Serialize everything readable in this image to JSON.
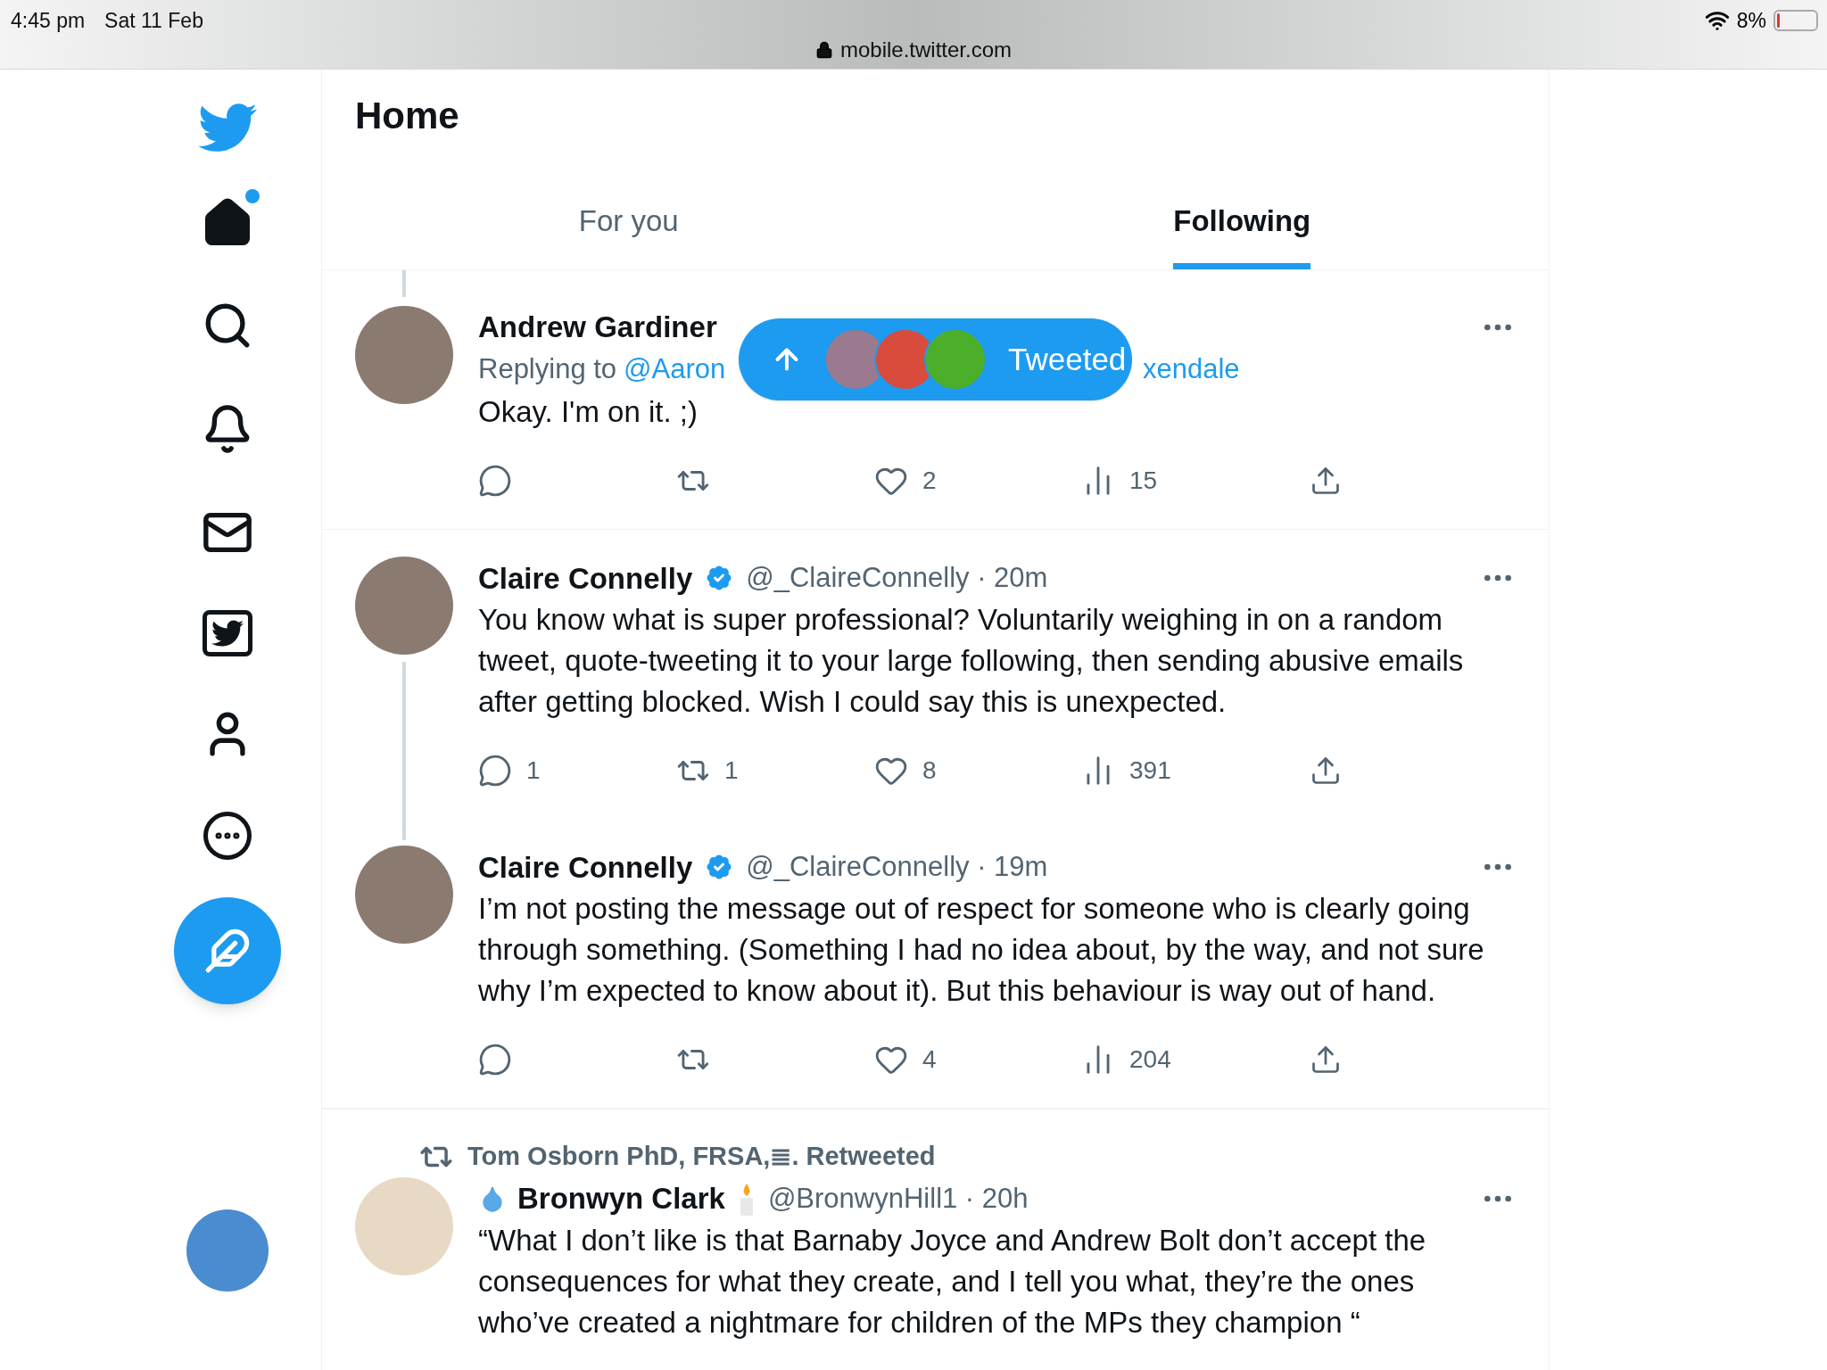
{
  "status_bar": {
    "time": "4:45 pm",
    "date": "Sat 11 Feb",
    "url": "mobile.twitter.com",
    "battery": "8%"
  },
  "sidebar": {
    "home_unread": true
  },
  "header": {
    "title": "Home"
  },
  "tabs": [
    {
      "label": "For you",
      "selected": false
    },
    {
      "label": "Following",
      "selected": true
    }
  ],
  "toast": {
    "label": "Tweeted"
  },
  "tweets": [
    {
      "name": "Andrew Gardiner",
      "verified": false,
      "reply_prefix": "Replying to",
      "reply_to": "@Aaron",
      "reply_tail": "xendale",
      "body": "Okay. I'm on it. ;)",
      "likes": "2",
      "views": "15",
      "thread_above": true,
      "thread_below": false,
      "divider": true
    },
    {
      "name": "Claire Connelly",
      "verified": true,
      "handle": "@_ClaireConnelly · 20m",
      "body": "You know what is super professional? Voluntarily weighing in on a random tweet, quote-tweeting it to your large following, then sending abusive emails after getting blocked. Wish I could say this is unexpected.",
      "replies": "1",
      "retweets": "1",
      "likes": "8",
      "views": "391",
      "thread_above": false,
      "thread_below": true,
      "divider": false
    },
    {
      "name": "Claire Connelly",
      "verified": true,
      "handle": "@_ClaireConnelly · 19m",
      "body": "I’m not posting the message out of respect for someone who is clearly going through something. (Something I had no idea about, by the way, and not sure why I’m expected to know about it). But this behaviour is way out of hand.",
      "likes": "4",
      "views": "204",
      "thread_above": true,
      "thread_below": false,
      "divider": true
    },
    {
      "retweeted_by": "Tom Osborn PhD, FRSA,≣. Retweeted",
      "name": "Bronwyn Clark",
      "name_prefix_icon": true,
      "name_suffix_icon": true,
      "verified": false,
      "handle": "@BronwynHill1 · 20h",
      "body": "“What I don’t like is that Barnaby Joyce and Andrew Bolt don’t accept the consequences for what they create, and I tell you what, they’re the ones who’ve created a nightmare for children of the MPs they champion “",
      "thread_above": false,
      "thread_below": false,
      "divider": false
    }
  ]
}
